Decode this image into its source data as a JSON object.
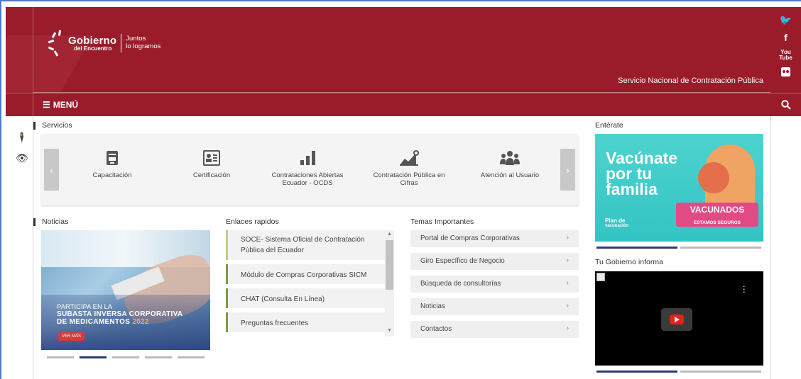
{
  "header": {
    "logo_name": "Gobierno",
    "logo_sub": "del Encuentro",
    "motto_line1": "Juntos",
    "motto_line2": "lo logramos",
    "agency": "Servicio Nacional de Contratación Pública"
  },
  "menu": {
    "label": "MENÚ"
  },
  "social": [
    "twitter-icon",
    "facebook-icon",
    "youtube-icon",
    "flickr-icon"
  ],
  "servicios": {
    "title": "Servicios",
    "items": [
      {
        "label": "Capacitación",
        "icon": "training-icon"
      },
      {
        "label": "Certificación",
        "icon": "certificate-icon"
      },
      {
        "label": "Contrataciones Abiertas Ecuador - OCDS",
        "icon": "bar-chart-icon"
      },
      {
        "label": "Contratación Pública en Cifras",
        "icon": "growth-chart-icon"
      },
      {
        "label": "Atención al Usuario",
        "icon": "users-group-icon"
      }
    ]
  },
  "noticias": {
    "title": "Noticias",
    "banner_line1": "PARTICIPA EN LA",
    "banner_line2": "SUBASTA INVERSA CORPORATIVA",
    "banner_line3": "DE MEDICAMENTOS",
    "banner_year": "2022",
    "banner_button": "VER MÁS"
  },
  "enlaces": {
    "title": "Enlaces rapidos",
    "items": [
      "SOCE- Sistema Oficial de Contratación Pública del Ecuador",
      "Módulo de Compras Corporativas SICM",
      "CHAT (Consulta En Línea)",
      "Preguntas frecuentes"
    ]
  },
  "temas": {
    "title": "Temas Importantes",
    "items": [
      "Portal de Compras Corporativas",
      "Giro Específico de Negocio",
      "Búsqueda de consultorías",
      "Noticias",
      "Contactos"
    ]
  },
  "enterate": {
    "title": "Entérate",
    "headline1": "Vacúnate",
    "headline2": "por tu",
    "headline3": "familia",
    "badge1": "VACUNADOS",
    "badge2": "ESTAMOS SEGUROS",
    "plan1": "Plan de",
    "plan2": "vacunación"
  },
  "gobierno_informa": {
    "title": "Tu Gobierno informa"
  },
  "colors": {
    "brand": "#9a1c2b",
    "accent_green": "#7a9a49",
    "teal": "#33c4c4",
    "navy": "#2a3d7a"
  }
}
